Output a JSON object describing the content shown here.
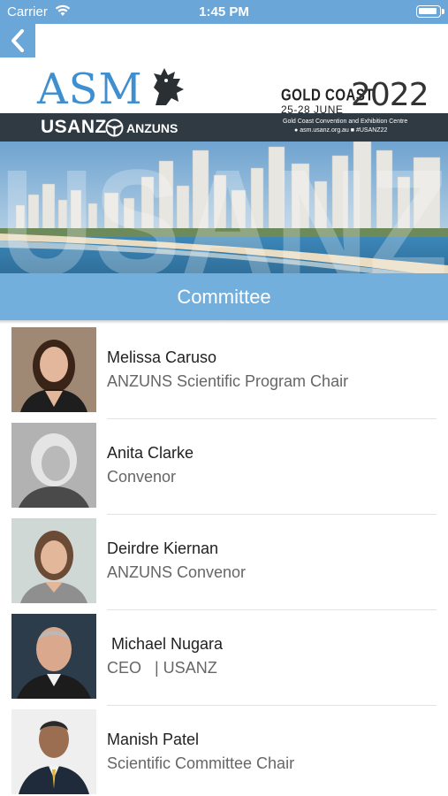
{
  "status_bar": {
    "carrier": "Carrier",
    "time": "1:45 PM"
  },
  "banner": {
    "asm": "ASM",
    "location": "GOLD COAST",
    "dates": "25-28 JUNE",
    "year": "2022",
    "usanz": "USANZ",
    "anzuns": "ANZUNS",
    "venue": "Gold Coast Convention and Exhibition Centre",
    "website": "asm.usanz.org.au",
    "hashtag": "#USANZ22",
    "watermark": "USANZ"
  },
  "section": {
    "title": "Committee"
  },
  "members": [
    {
      "name": "Melissa Caruso",
      "role": "ANZUNS Scientific Program Chair"
    },
    {
      "name": "Anita Clarke",
      "role": "Convenor"
    },
    {
      "name": "Deirdre Kiernan",
      "role": "ANZUNS Convenor"
    },
    {
      "name": " Michael Nugara",
      "role": "CEO   | USANZ"
    },
    {
      "name": "Manish Patel",
      "role": "Scientific Committee Chair"
    }
  ],
  "colors": {
    "accent": "#6aa6d8",
    "header": "#73afdd",
    "asm_blue": "#3f8fd0",
    "dark_band": "#2f3a42"
  }
}
